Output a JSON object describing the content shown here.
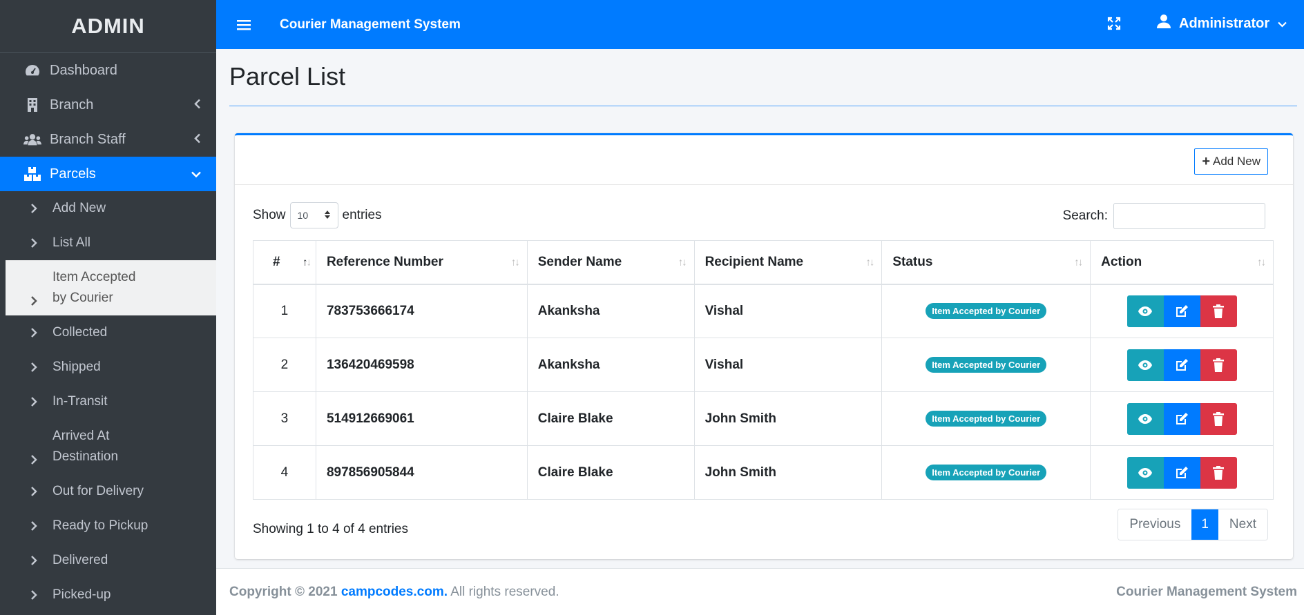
{
  "sidebar": {
    "brand": "ADMIN",
    "items": [
      {
        "label": "Dashboard",
        "icon": "tachometer-icon"
      },
      {
        "label": "Branch",
        "icon": "building-icon"
      },
      {
        "label": "Branch Staff",
        "icon": "users-icon"
      },
      {
        "label": "Parcels",
        "icon": "boxes-icon"
      }
    ],
    "submenu": [
      {
        "label": "Add New"
      },
      {
        "label": "List All"
      },
      {
        "line1": "Item Accepted",
        "line2": "by Courier"
      },
      {
        "label": "Collected"
      },
      {
        "label": "Shipped"
      },
      {
        "label": "In-Transit"
      },
      {
        "line1": "Arrived At",
        "line2": "Destination"
      },
      {
        "label": "Out for Delivery"
      },
      {
        "label": "Ready to Pickup"
      },
      {
        "label": "Delivered"
      },
      {
        "label": "Picked-up"
      }
    ]
  },
  "header": {
    "title": "Courier Management System",
    "user": "Administrator"
  },
  "page": {
    "title": "Parcel List",
    "add_new": "Add New",
    "show_label": "Show",
    "entries_label": "entries",
    "page_size": "10",
    "search_label": "Search:"
  },
  "table": {
    "columns": [
      "#",
      "Reference Number",
      "Sender Name",
      "Recipient Name",
      "Status",
      "Action"
    ],
    "rows": [
      {
        "num": "1",
        "ref": "783753666174",
        "sender": "Akanksha",
        "recipient": "Vishal",
        "status": "Item Accepted by Courier"
      },
      {
        "num": "2",
        "ref": "136420469598",
        "sender": "Akanksha",
        "recipient": "Vishal",
        "status": "Item Accepted by Courier"
      },
      {
        "num": "3",
        "ref": "514912669061",
        "sender": "Claire Blake",
        "recipient": "John Smith",
        "status": "Item Accepted by Courier"
      },
      {
        "num": "4",
        "ref": "897856905844",
        "sender": "Claire Blake",
        "recipient": "John Smith",
        "status": "Item Accepted by Courier"
      }
    ]
  },
  "pagination": {
    "info": "Showing 1 to 4 of 4 entries",
    "previous": "Previous",
    "current": "1",
    "next": "Next"
  },
  "footer": {
    "copyright": "Copyright © 2021",
    "link": "campcodes.com.",
    "rights": "All rights reserved.",
    "right": "Courier Management System"
  },
  "colors": {
    "primary": "#007bff",
    "sidebar": "#343a40",
    "info": "#17a2b8",
    "danger": "#dc3545"
  }
}
